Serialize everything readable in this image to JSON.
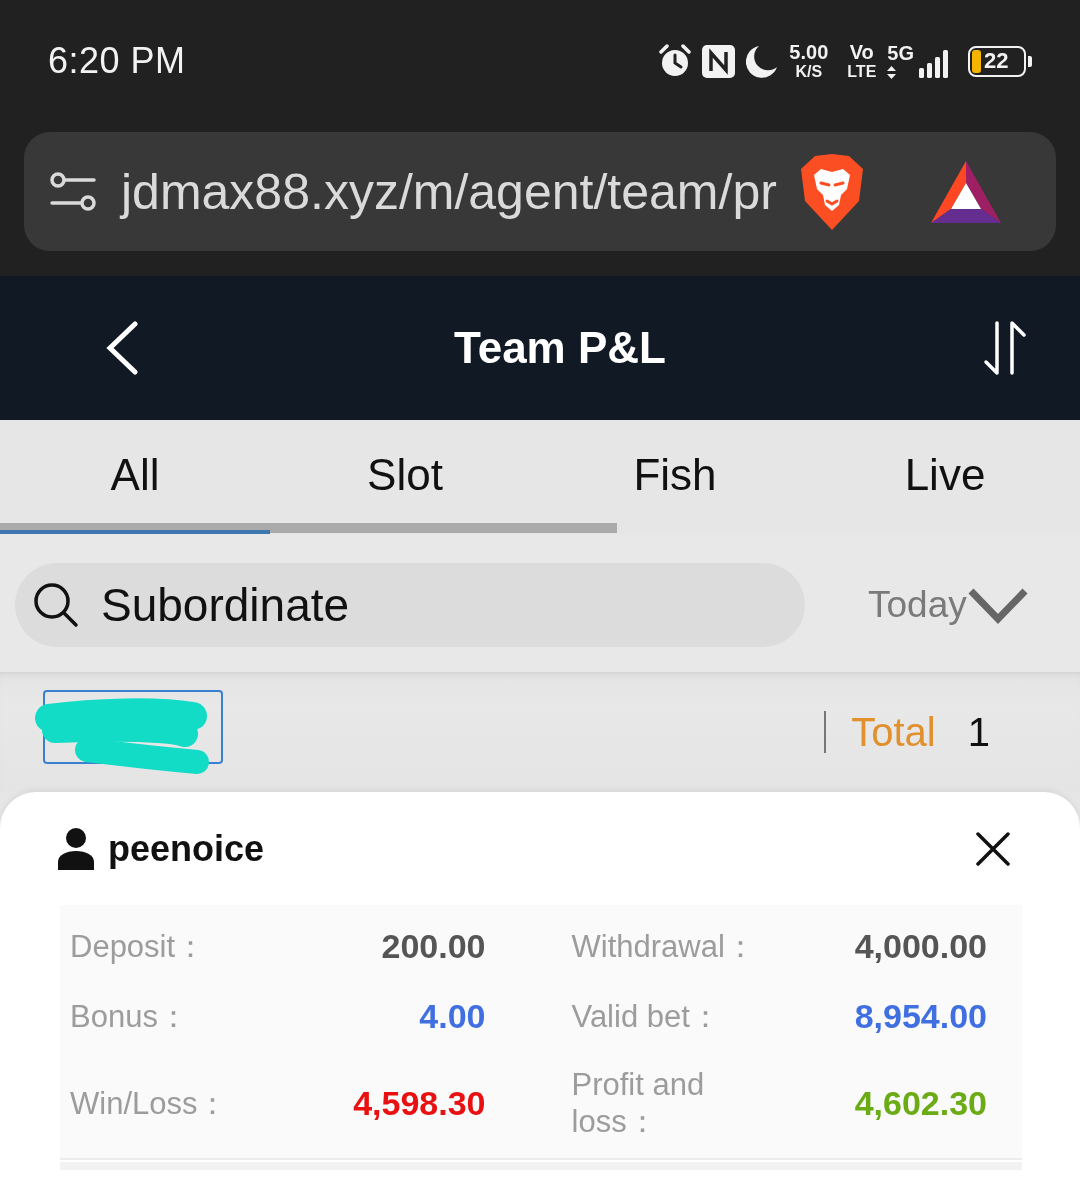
{
  "status_bar": {
    "time": "6:20 PM",
    "net_speed": "5.00",
    "net_speed_unit": "K/S",
    "volte_top": "Vo",
    "volte_bottom": "LTE",
    "network_type": "5G",
    "battery": "22"
  },
  "address_bar": {
    "url": "jdmax88.xyz/m/agent/team/pr"
  },
  "header": {
    "title": "Team P&L"
  },
  "tabs": [
    {
      "label": "All",
      "selected": true
    },
    {
      "label": "Slot",
      "selected": false
    },
    {
      "label": "Fish",
      "selected": false
    },
    {
      "label": "Live",
      "selected": false
    }
  ],
  "search": {
    "placeholder": "Subordinate"
  },
  "date_filter": {
    "value": "Today"
  },
  "summary": {
    "label": "Total",
    "count": "1"
  },
  "detail_card": {
    "username": "peenoice",
    "stat_rows": [
      [
        {
          "label": "Deposit：",
          "value": "200.00",
          "color": "#555555"
        },
        {
          "label": "Withdrawal：",
          "value": "4,000.00",
          "color": "#555555"
        }
      ],
      [
        {
          "label": "Bonus：",
          "value": "4.00",
          "color": "#3f6fe0"
        },
        {
          "label": "Valid bet：",
          "value": "8,954.00",
          "color": "#3f6fe0"
        }
      ],
      [
        {
          "label": "Win/Loss：",
          "value": "4,598.30",
          "color": "#e81010"
        },
        {
          "label": "Profit and loss：",
          "value": "4,602.30",
          "color": "#6aab16"
        }
      ]
    ]
  }
}
